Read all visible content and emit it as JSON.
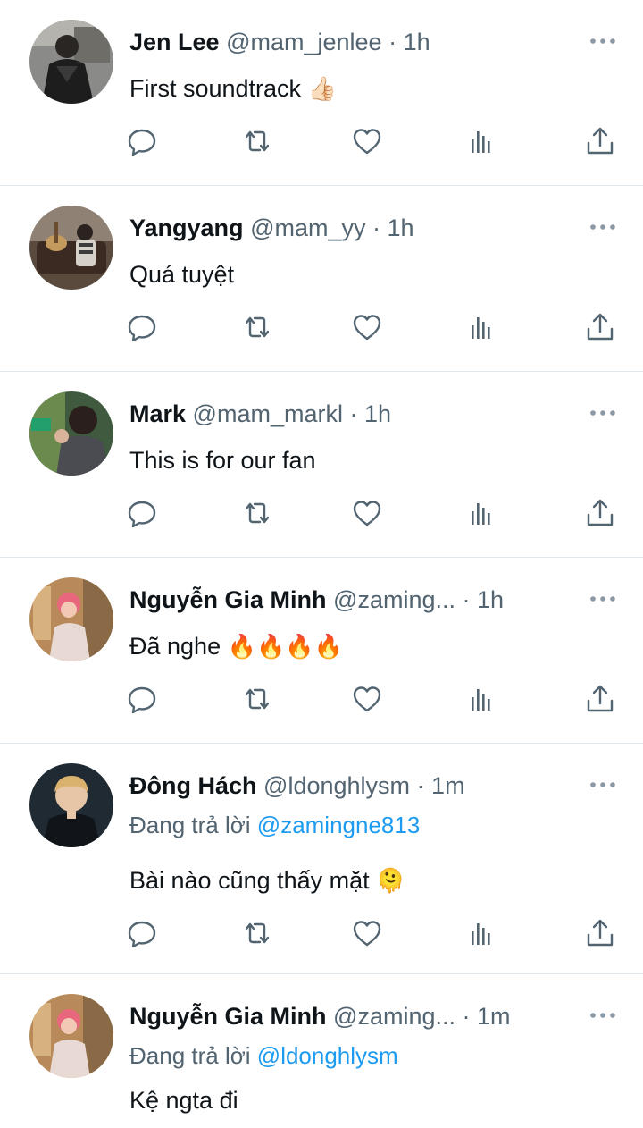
{
  "tweets": [
    {
      "name": "Jen Lee",
      "handle": "@mam_jenlee",
      "dot": "·",
      "time": "1h",
      "text": "First soundtrack",
      "emoji": "👍🏻"
    },
    {
      "name": "Yangyang",
      "handle": "@mam_yy",
      "dot": "·",
      "time": "1h",
      "text": "Quá tuyệt",
      "emoji": ""
    },
    {
      "name": "Mark",
      "handle": "@mam_markl",
      "dot": "·",
      "time": "1h",
      "text": "This is for our fan",
      "emoji": ""
    },
    {
      "name": "Nguyễn Gia Minh",
      "handle": "@zaming...",
      "dot": "·",
      "time": "1h",
      "text": "Đã nghe",
      "emoji": "🔥🔥🔥🔥"
    },
    {
      "name": "Đông Hách",
      "handle": "@ldonghlysm",
      "dot": "·",
      "time": "1m",
      "reply_prefix": "Đang trả lời",
      "reply_mention": "@zamingne813",
      "text": "Bài nào cũng thấy mặt",
      "emoji": "🫠"
    },
    {
      "name": "Nguyễn Gia Minh",
      "handle": "@zaming...",
      "dot": "·",
      "time": "1m",
      "reply_prefix": "Đang trả lời",
      "reply_mention": "@ldonghlysm",
      "text": "Kệ ngta đi",
      "emoji": ""
    }
  ],
  "icons": {
    "reply": "reply-icon",
    "retweet": "retweet-icon",
    "like": "heart-icon",
    "views": "analytics-icon",
    "share": "share-icon",
    "more": "more-dots-icon"
  },
  "colors": {
    "icon": "#536471",
    "mention": "#1d9bf0",
    "divider": "#e1e8ed"
  }
}
